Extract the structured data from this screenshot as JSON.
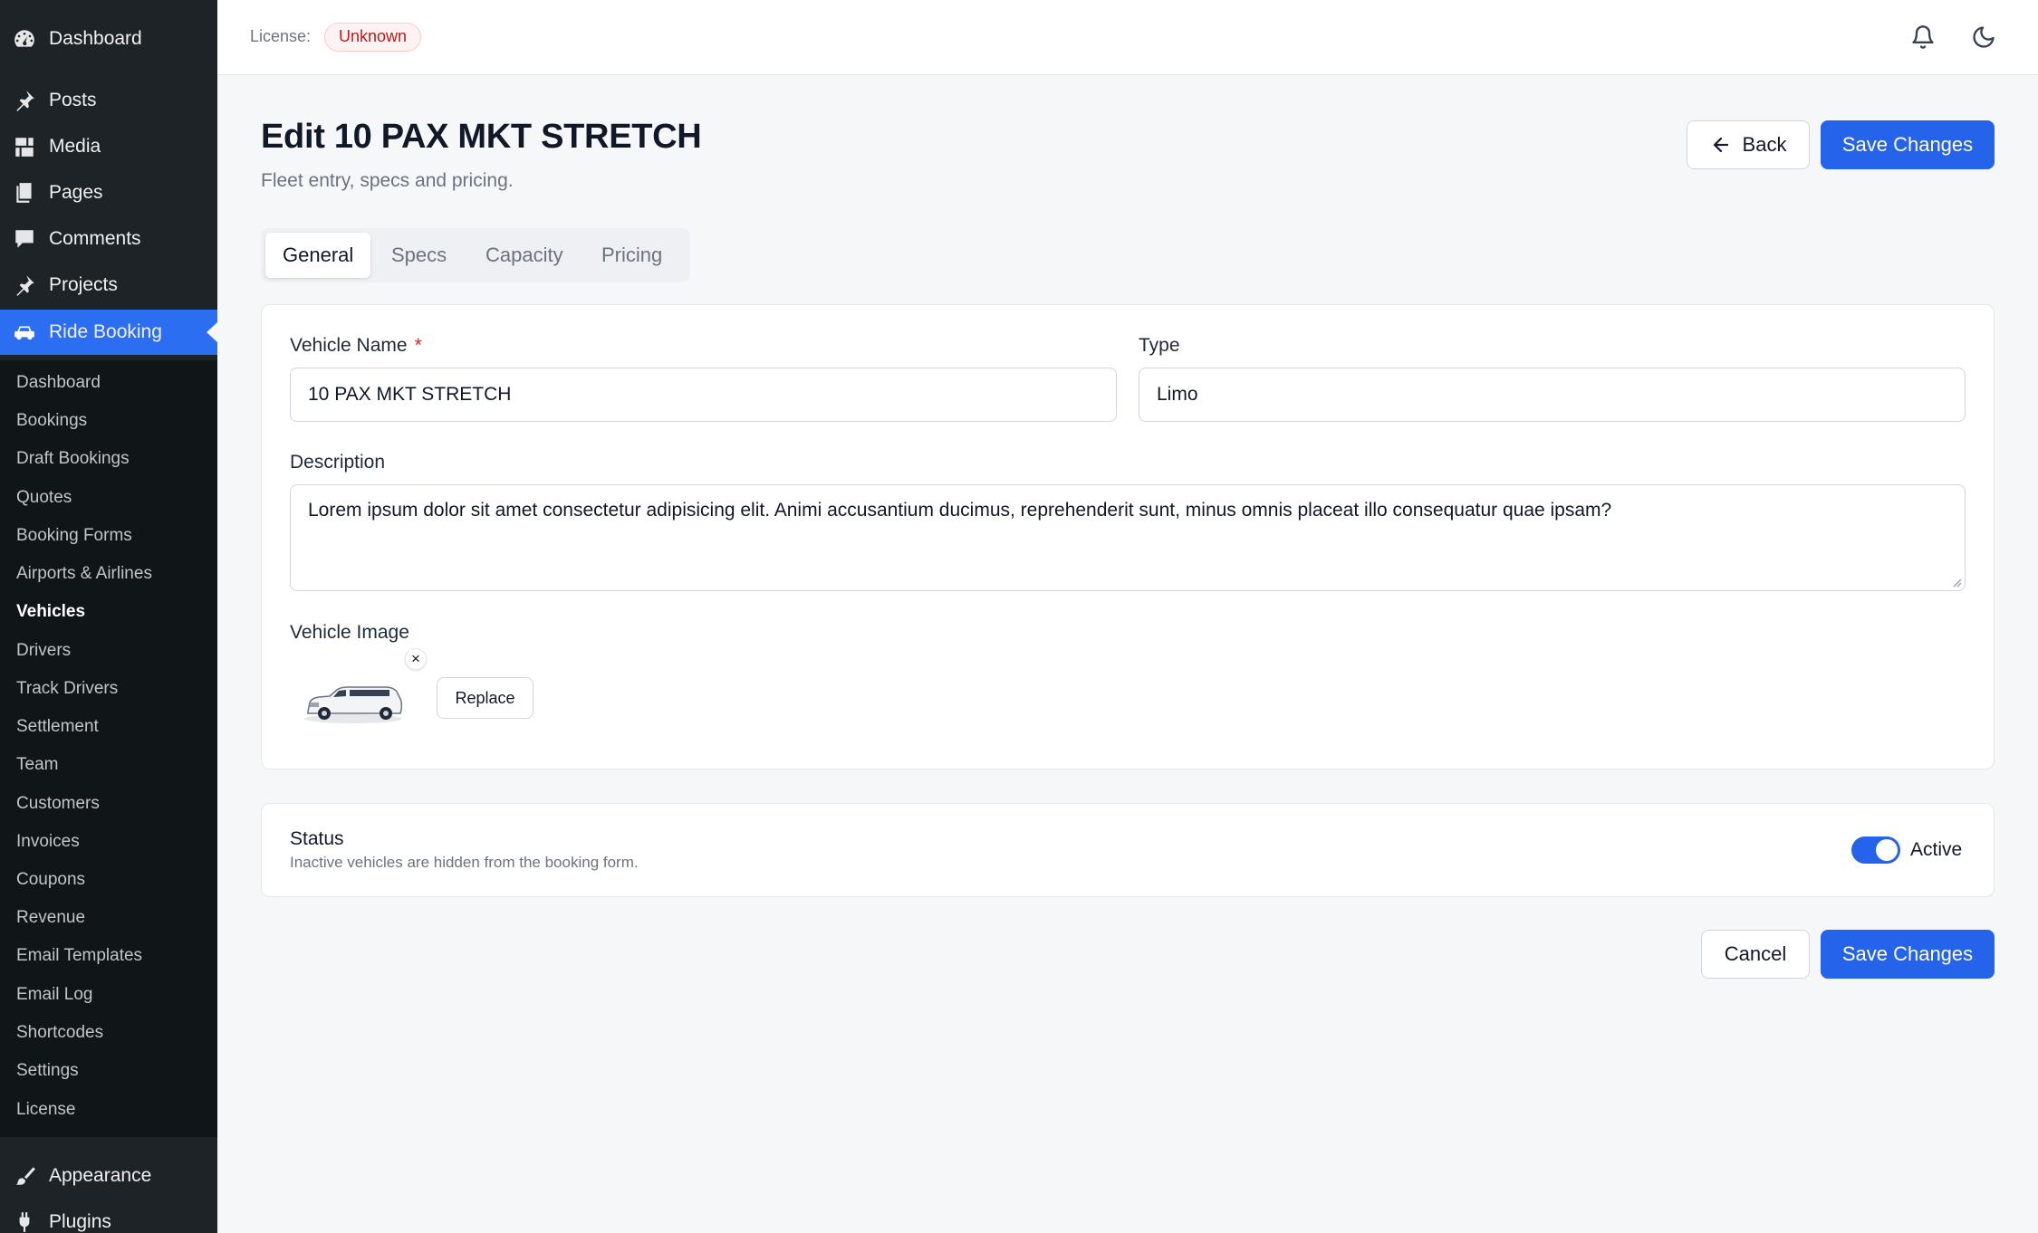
{
  "sidebar": {
    "top_items": [
      {
        "label": "Dashboard",
        "icon": "dashboard-icon"
      },
      {
        "label": "Posts",
        "icon": "pin-icon"
      },
      {
        "label": "Media",
        "icon": "media-icon"
      },
      {
        "label": "Pages",
        "icon": "pages-icon"
      },
      {
        "label": "Comments",
        "icon": "comments-icon"
      },
      {
        "label": "Projects",
        "icon": "pin-icon"
      },
      {
        "label": "Ride Booking",
        "icon": "car-icon"
      }
    ],
    "sub_items": [
      "Dashboard",
      "Bookings",
      "Draft Bookings",
      "Quotes",
      "Booking Forms",
      "Airports & Airlines",
      "Vehicles",
      "Drivers",
      "Track Drivers",
      "Settlement",
      "Team",
      "Customers",
      "Invoices",
      "Coupons",
      "Revenue",
      "Email Templates",
      "Email Log",
      "Shortcodes",
      "Settings",
      "License"
    ],
    "current_sub_item": "Vehicles",
    "bottom_items": [
      {
        "label": "Appearance",
        "icon": "brush-icon"
      },
      {
        "label": "Plugins",
        "icon": "plugin-icon"
      }
    ]
  },
  "topbar": {
    "license_label": "License:",
    "license_status": "Unknown"
  },
  "page": {
    "title": "Edit 10 PAX MKT STRETCH",
    "subtitle": "Fleet entry, specs and pricing.",
    "back_label": "Back",
    "save_label": "Save Changes"
  },
  "tabs": [
    "General",
    "Specs",
    "Capacity",
    "Pricing"
  ],
  "active_tab": "General",
  "form": {
    "vehicle_name_label": "Vehicle Name",
    "required_mark": "*",
    "vehicle_name_value": "10 PAX MKT STRETCH",
    "type_label": "Type",
    "type_value": "Limo",
    "description_label": "Description",
    "description_value": "Lorem ipsum dolor sit amet consectetur adipisicing elit. Animi accusantium ducimus, reprehenderit sunt, minus omnis placeat illo consequatur quae ipsam?",
    "image_label": "Vehicle Image",
    "remove_symbol": "×",
    "replace_label": "Replace"
  },
  "status": {
    "title": "Status",
    "description": "Inactive vehicles are hidden from the booking form.",
    "toggle_label": "Active",
    "active": true
  },
  "footer": {
    "cancel_label": "Cancel",
    "save_label": "Save Changes"
  },
  "colors": {
    "sidebar_bg": "#1d2327",
    "submenu_bg": "#101517",
    "accent": "#2563eb",
    "badge_text": "#b91c1c"
  }
}
